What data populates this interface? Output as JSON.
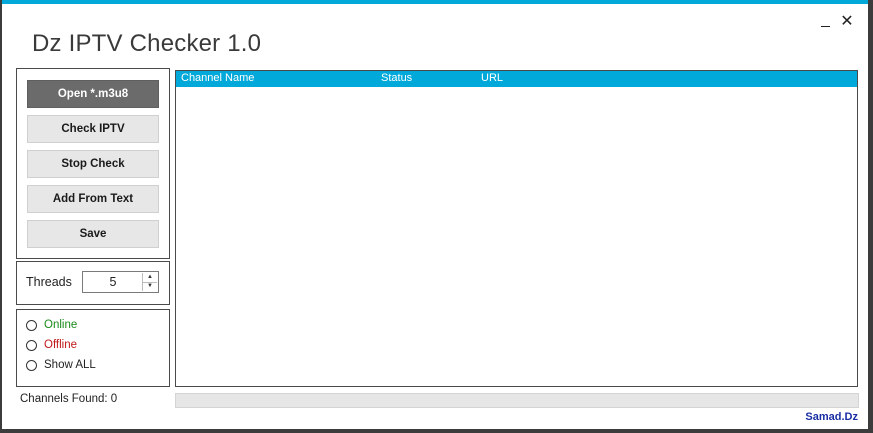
{
  "window": {
    "title": "Dz IPTV Checker 1.0",
    "minimize_label": "",
    "close_label": "✕",
    "accent_color": "#00a9d9"
  },
  "buttons": {
    "open": "Open *.m3u8",
    "check": "Check IPTV",
    "stop": "Stop Check",
    "add_text": "Add From Text",
    "save": "Save"
  },
  "threads": {
    "label": "Threads",
    "value": "5"
  },
  "filter": {
    "online": "Online",
    "offline": "Offline",
    "show_all": "Show ALL",
    "online_color": "#1a8a1a",
    "offline_color": "#c01818"
  },
  "table": {
    "columns": [
      "Channel Name",
      "Status",
      "URL"
    ],
    "rows": []
  },
  "status": {
    "channels_found": "Channels Found:  0",
    "progress_fraction": 0
  },
  "credit": "Samad.Dz"
}
